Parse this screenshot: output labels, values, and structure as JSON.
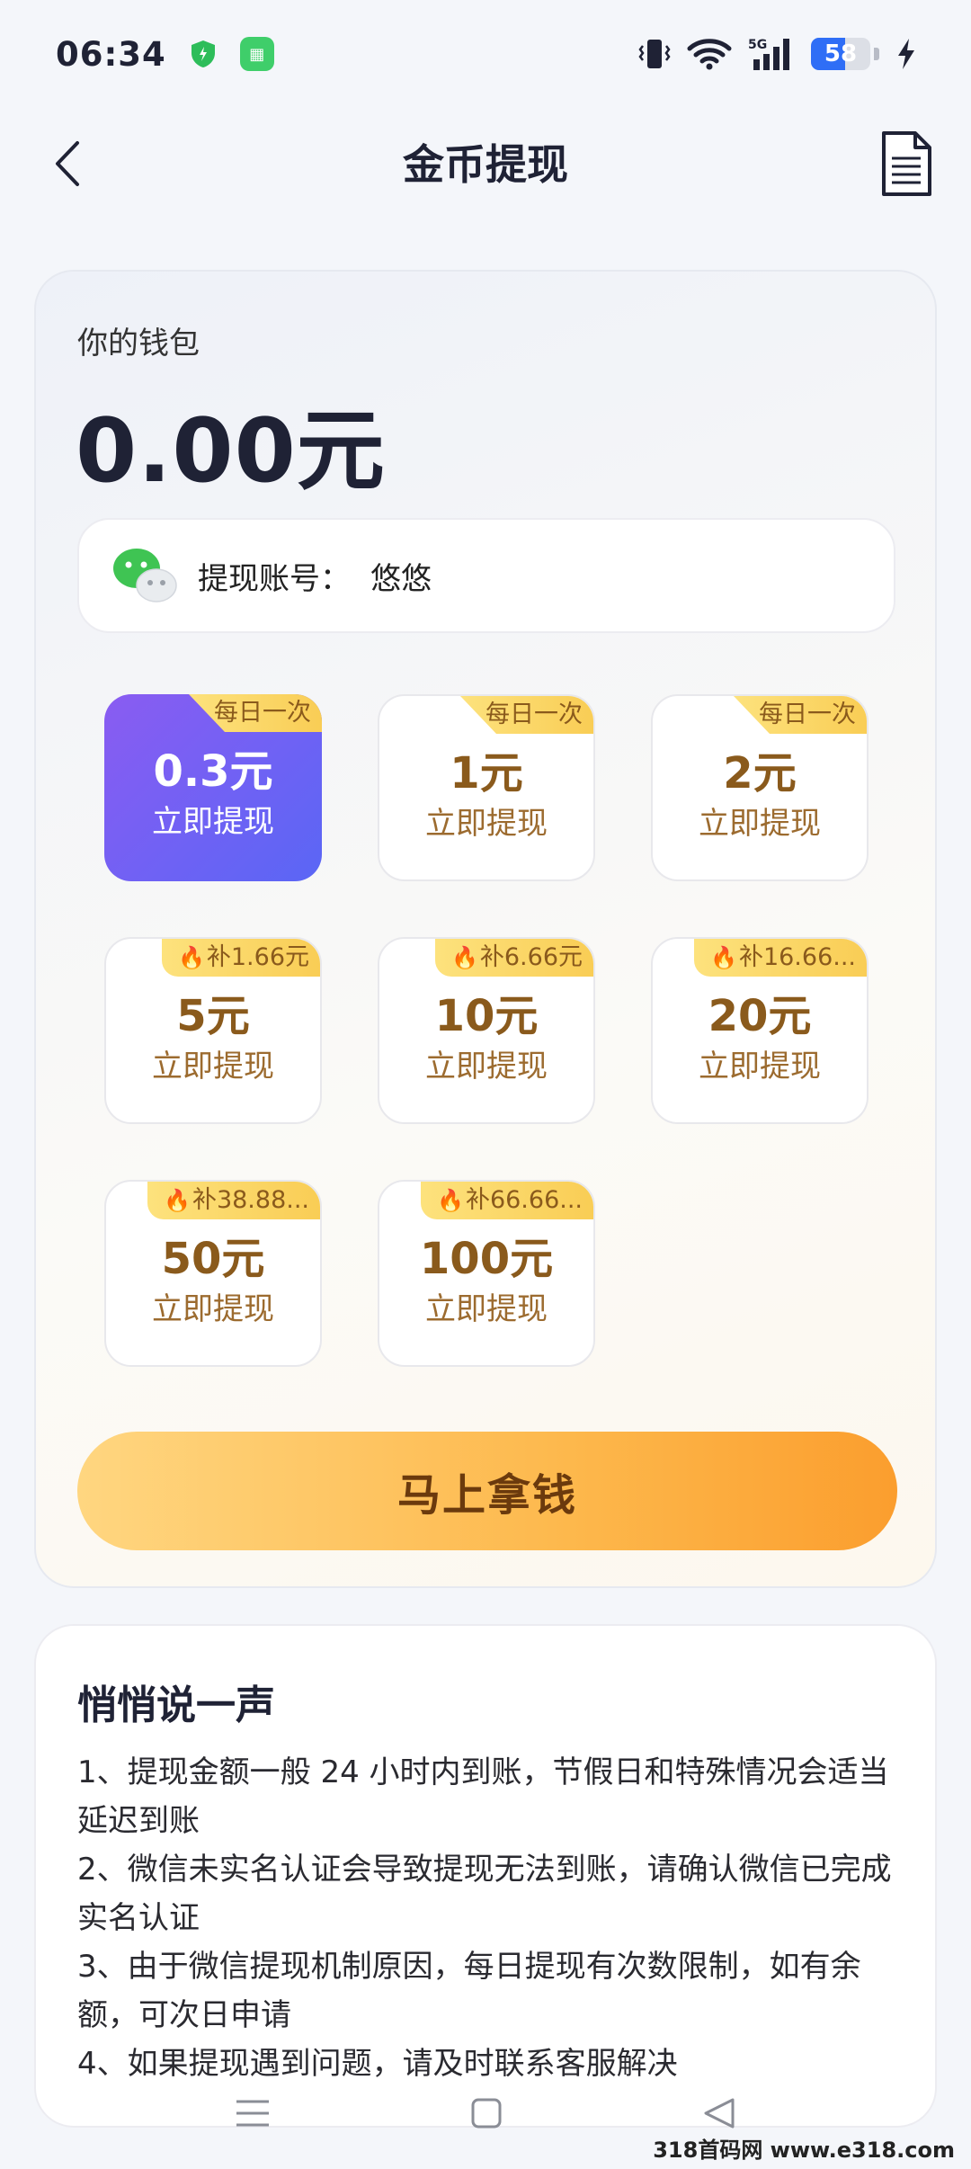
{
  "status_bar": {
    "time": "06:34",
    "battery_level": "58",
    "network": "5G"
  },
  "header": {
    "title": "金币提现"
  },
  "wallet": {
    "label": "你的钱包",
    "amount": "0.00元",
    "account_label": "提现账号：",
    "account_name": "悠悠"
  },
  "options": [
    {
      "tag": "每日一次",
      "amount": "0.3元",
      "action": "立即提现",
      "selected": true
    },
    {
      "tag": "每日一次",
      "amount": "1元",
      "action": "立即提现",
      "selected": false
    },
    {
      "tag": "每日一次",
      "amount": "2元",
      "action": "立即提现",
      "selected": false
    },
    {
      "tag": "补1.66元",
      "amount": "5元",
      "action": "立即提现",
      "selected": false
    },
    {
      "tag": "补6.66元",
      "amount": "10元",
      "action": "立即提现",
      "selected": false
    },
    {
      "tag": "补16.66...",
      "amount": "20元",
      "action": "立即提现",
      "selected": false
    },
    {
      "tag": "补38.88...",
      "amount": "50元",
      "action": "立即提现",
      "selected": false
    },
    {
      "tag": "补66.66...",
      "amount": "100元",
      "action": "立即提现",
      "selected": false
    }
  ],
  "cta": {
    "label": "马上拿钱"
  },
  "tips": {
    "title": "悄悄说一声",
    "items": [
      "1、提现金额一般 24 小时内到账，节假日和特殊情况会适当延迟到账",
      "2、微信未实名认证会导致提现无法到账，请确认微信已完成实名认证",
      "3、由于微信提现机制原因，每日提现有次数限制，如有余额，可次日申请",
      "4、如果提现遇到问题，请及时联系客服解决"
    ]
  },
  "watermark": "318首码网 www.e318.com",
  "colors": {
    "selected_gradient_start": "#8a5cf2",
    "selected_gradient_end": "#5a66f5",
    "cta_start": "#ffd680",
    "cta_end": "#fb9e2e",
    "amount_text": "#8a5a1c"
  }
}
